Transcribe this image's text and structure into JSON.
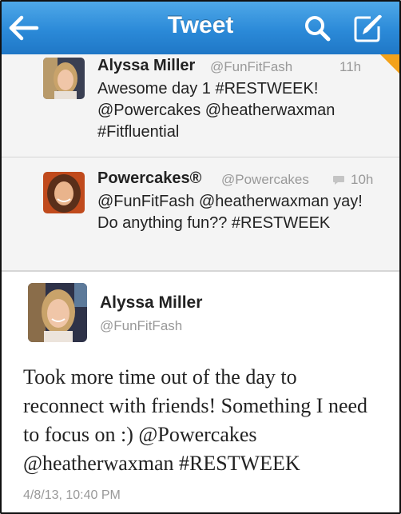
{
  "header": {
    "title": "Tweet",
    "back_icon": "back-arrow-icon",
    "search_icon": "search-icon",
    "compose_icon": "compose-icon",
    "bar_color": "#2b8ad8"
  },
  "replies": [
    {
      "name": "Alyssa Miller",
      "handle": "@FunFitFash",
      "time": "11h",
      "text": "Awesome day 1 #RESTWEEK! @Powercakes @heatherwaxman #Fitfluential"
    },
    {
      "name": "Powercakes®",
      "handle": "@Powercakes",
      "time": "10h",
      "text": "@FunFitFash @heatherwaxman yay! Do anything fun?? #RESTWEEK",
      "icon": "reply-bubble-icon"
    }
  ],
  "tweet": {
    "name": "Alyssa Miller",
    "handle": "@FunFitFash",
    "text": "Took more time out of the day to reconnect with friends! Something I need to focus on :) @Powercakes @heatherwaxman #RESTWEEK",
    "timestamp": "4/8/13, 10:40 PM"
  },
  "colors": {
    "ribbon": "#f3a21a",
    "handle": "#999999"
  }
}
